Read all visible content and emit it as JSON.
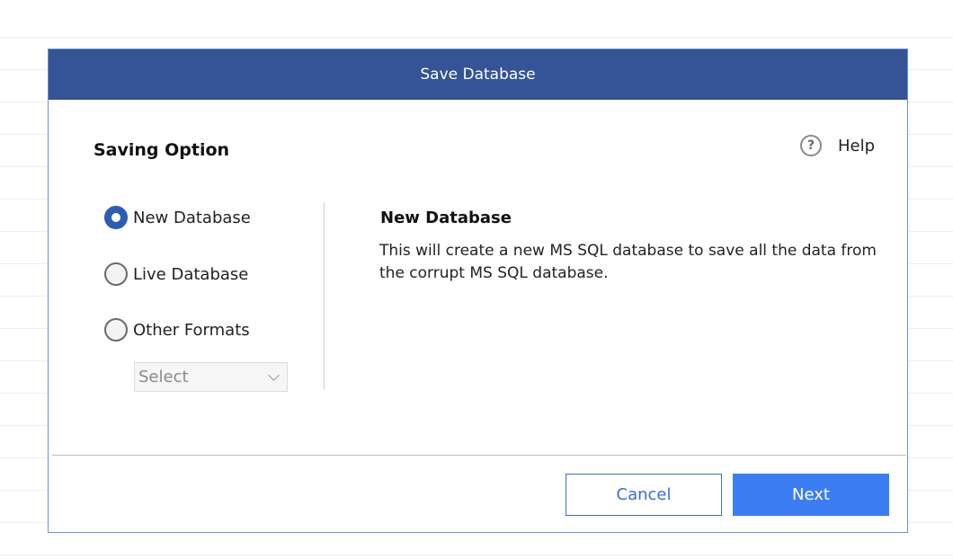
{
  "dialog": {
    "title": "Save Database"
  },
  "saving_option": {
    "title": "Saving Option",
    "help_label": "Help",
    "options": [
      {
        "label": "New Database",
        "checked": true
      },
      {
        "label": "Live Database",
        "checked": false
      },
      {
        "label": "Other Formats",
        "checked": false
      }
    ],
    "format_select": {
      "value": "Select"
    }
  },
  "description": {
    "title": "New Database",
    "text": "This will create a new MS SQL database to save all the data from the corrupt MS SQL database."
  },
  "buttons": {
    "cancel": "Cancel",
    "next": "Next"
  },
  "colors": {
    "header_bg": "#345496",
    "accent": "#3c7df3",
    "radio_checked": "#2c5cb4"
  }
}
